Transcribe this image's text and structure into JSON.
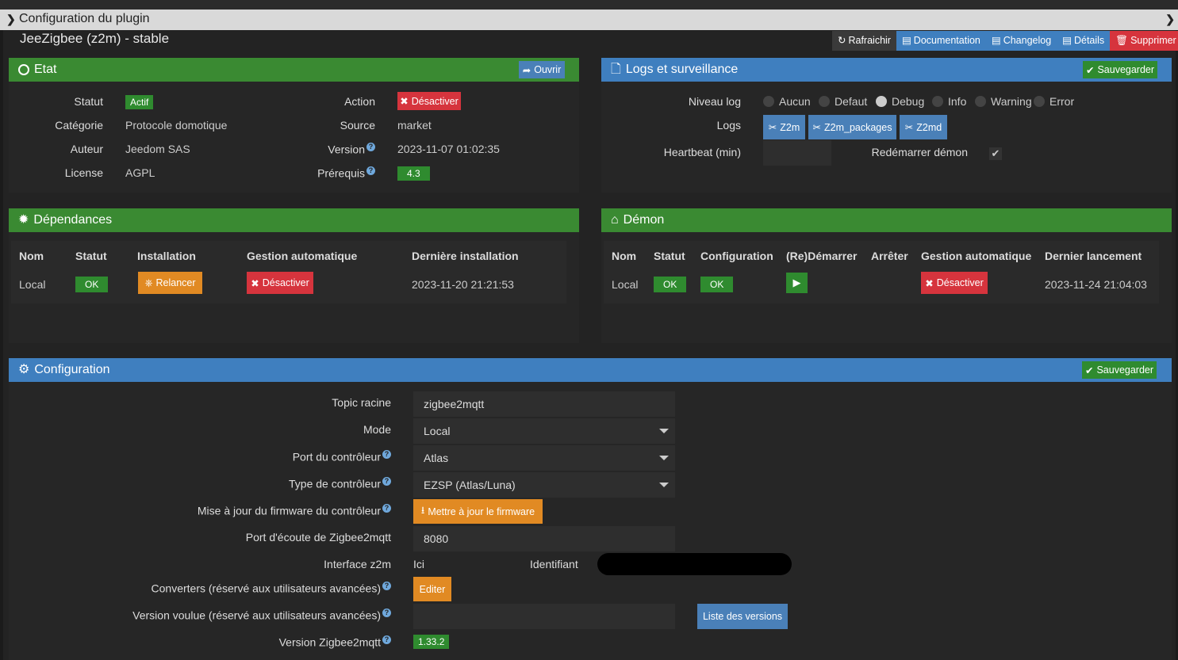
{
  "header": {
    "title": "Configuration du plugin",
    "plugin_name": "JeeZigbee (z2m) - stable"
  },
  "toolbar": {
    "refresh": "Rafraichir",
    "documentation": "Documentation",
    "changelog": "Changelog",
    "details": "Détails",
    "delete": "Supprimer"
  },
  "etat": {
    "title": "Etat",
    "open_label": "Ouvrir",
    "statut_label": "Statut",
    "statut_value": "Actif",
    "categorie_label": "Catégorie",
    "categorie_value": "Protocole domotique",
    "auteur_label": "Auteur",
    "auteur_value": "Jeedom SAS",
    "license_label": "License",
    "license_value": "AGPL",
    "action_label": "Action",
    "action_value": "Désactiver",
    "source_label": "Source",
    "source_value": "market",
    "version_label": "Version",
    "version_value": "2023-11-07 01:02:35",
    "prerequis_label": "Prérequis",
    "prerequis_value": "4.3"
  },
  "logs": {
    "title": "Logs et surveillance",
    "save_label": "Sauvegarder",
    "niveau_label": "Niveau log",
    "levels": [
      "Aucun",
      "Defaut",
      "Debug",
      "Info",
      "Warning",
      "Error"
    ],
    "selected_level": "Debug",
    "logs_label": "Logs",
    "log_buttons": [
      "Z2m",
      "Z2m_packages",
      "Z2md"
    ],
    "heartbeat_label": "Heartbeat (min)",
    "heartbeat_value": "",
    "restart_label": "Redémarrer démon"
  },
  "dependances": {
    "title": "Dépendances",
    "headers": [
      "Nom",
      "Statut",
      "Installation",
      "Gestion automatique",
      "Dernière installation"
    ],
    "row": {
      "nom": "Local",
      "statut": "OK",
      "installation": "Relancer",
      "gestion": "Désactiver",
      "derniere": "2023-11-20 21:21:53"
    }
  },
  "demon": {
    "title": "Démon",
    "headers": [
      "Nom",
      "Statut",
      "Configuration",
      "(Re)Démarrer",
      "Arrêter",
      "Gestion automatique",
      "Dernier lancement"
    ],
    "row": {
      "nom": "Local",
      "statut": "OK",
      "configuration": "OK",
      "gestion": "Désactiver",
      "dernier": "2023-11-24 21:04:03"
    }
  },
  "configuration": {
    "title": "Configuration",
    "save_label": "Sauvegarder",
    "topic_label": "Topic racine",
    "topic_value": "zigbee2mqtt",
    "mode_label": "Mode",
    "mode_value": "Local",
    "port_label": "Port du contrôleur",
    "port_value": "Atlas",
    "type_label": "Type de contrôleur",
    "type_value": "EZSP (Atlas/Luna)",
    "firmware_label": "Mise à jour du firmware du contrôleur",
    "firmware_button": "Mettre à jour le firmware",
    "ecoute_label": "Port d'écoute de Zigbee2mqtt",
    "ecoute_value": "8080",
    "interface_label": "Interface z2m",
    "interface_value": "Ici",
    "identifiant_label": "Identifiant",
    "converters_label": "Converters (réservé aux utilisateurs avancées)",
    "converters_button": "Editer",
    "version_voulue_label": "Version voulue (réservé aux utilisateurs avancées)",
    "version_voulue_value": "",
    "liste_versions_button": "Liste des versions",
    "version_z2m_label": "Version Zigbee2mqtt",
    "version_z2m_value": "1.33.2"
  }
}
